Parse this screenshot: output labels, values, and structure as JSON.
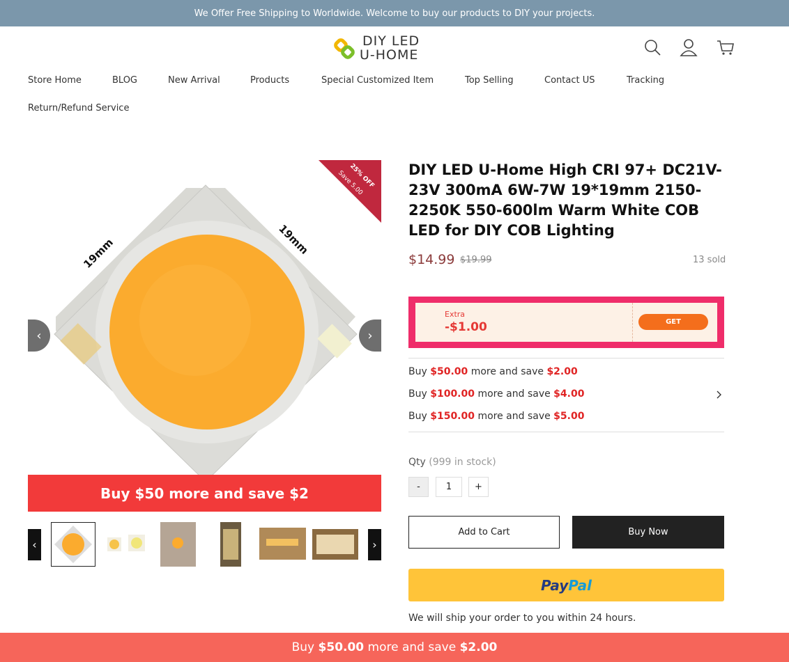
{
  "announcement": "We Offer Free Shipping to Worldwide. Welcome to buy our products to DIY your projects.",
  "logo": {
    "line1": "DIY LED",
    "line2": "U-HOME"
  },
  "header_icons": [
    "search-icon",
    "account-icon",
    "cart-icon"
  ],
  "nav": [
    "Store Home",
    "BLOG",
    "New Arrival",
    "Products",
    "Special Customized Item",
    "Top Selling",
    "Contact US",
    "Tracking",
    "Return/Refund Service"
  ],
  "gallery": {
    "ribbon_line1": "25% OFF",
    "ribbon_line2": "Save 5.00",
    "dim_label_left": "19mm",
    "dim_label_right": "19mm",
    "banner": "Buy $50 more and save $2"
  },
  "product": {
    "title": "DIY LED U-Home High CRI 97+ DC21V-23V 300mA 6W-7W 19*19mm 2150-2250K 550-600lm Warm White COB LED for DIY COB Lighting",
    "price": "$14.99",
    "old_price": "$19.99",
    "sold": "13 sold"
  },
  "coupon": {
    "label": "Extra",
    "value": "-$1.00",
    "button": "GET"
  },
  "promos": [
    {
      "buy": "Buy",
      "amount": "$50.00",
      "mid": "more and save",
      "save": "$2.00"
    },
    {
      "buy": "Buy",
      "amount": "$100.00",
      "mid": "more and save",
      "save": "$4.00"
    },
    {
      "buy": "Buy",
      "amount": "$150.00",
      "mid": "more and save",
      "save": "$5.00"
    }
  ],
  "qty": {
    "label": "Qty",
    "stock": "(999 in stock)",
    "minus": "-",
    "value": "1",
    "plus": "+"
  },
  "buttons": {
    "add_to_cart": "Add to Cart",
    "buy_now": "Buy Now",
    "paypal_1": "Pay",
    "paypal_2": "Pal"
  },
  "ship_note": "We will ship your order to you within 24 hours.",
  "footer_bar": {
    "prefix": "Buy",
    "amount": "$50.00",
    "mid": "more and save",
    "save": "$2.00"
  },
  "colors": {
    "topbar": "#7b97ab",
    "price": "#8b3a3a",
    "promo": "#e02424",
    "coupon": "#ef2d6a",
    "footer": "#f6655a"
  }
}
